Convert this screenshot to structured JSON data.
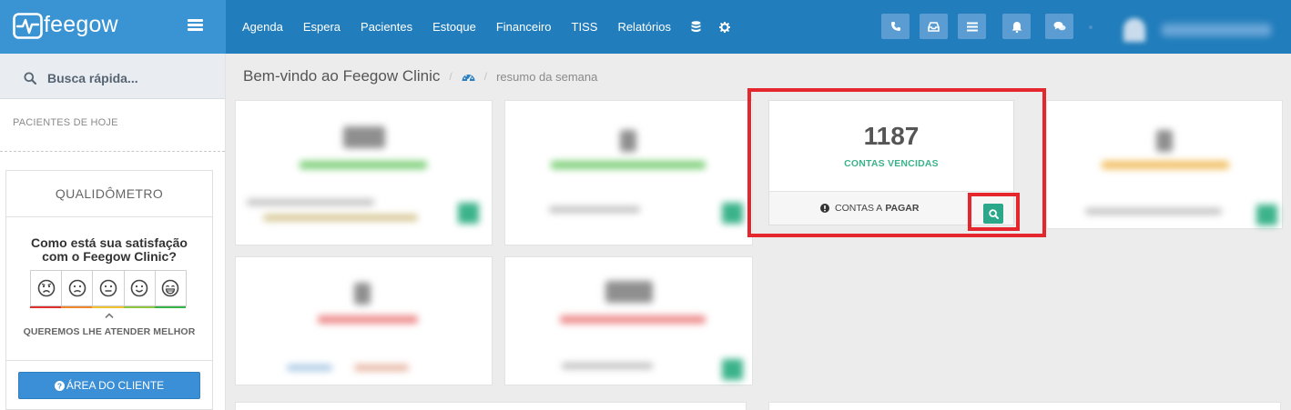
{
  "header": {
    "brand_name": "feegow",
    "nav": [
      "Agenda",
      "Espera",
      "Pacientes",
      "Estoque",
      "Financeiro",
      "TISS",
      "Relatórios"
    ],
    "nav_icons": [
      "database-icon",
      "gear-icon"
    ],
    "toolbar_buttons": [
      "phone-icon",
      "inbox-icon",
      "list-icon",
      "bell-icon",
      "chat-icon"
    ]
  },
  "sidebar": {
    "search_placeholder": "Busca rápida...",
    "pacientes_hoje": "PACIENTES DE HOJE",
    "qualidometro": {
      "title": "QUALIDÔMETRO",
      "question": "Como está sua satisfação com o Feegow Clinic?",
      "faces": [
        {
          "name": "very-unhappy-face-icon",
          "color": "#e0302e"
        },
        {
          "name": "unhappy-face-icon",
          "color": "#f0862b"
        },
        {
          "name": "neutral-face-icon",
          "color": "#f3c32f"
        },
        {
          "name": "happy-face-icon",
          "color": "#8dc63f"
        },
        {
          "name": "very-happy-face-icon",
          "color": "#37b34a"
        }
      ],
      "subtitle": "QUEREMOS LHE ATENDER MELHOR",
      "button_label": "ÁREA DO CLIENTE"
    }
  },
  "breadcrumb": {
    "title": "Bem-vindo ao Feegow Clinic",
    "sub": "resumo da semana"
  },
  "focused_card": {
    "value": "1187",
    "label": "CONTAS VENCIDAS",
    "footer_prefix": "CONTAS A",
    "footer_bold": "PAGAR"
  },
  "colors": {
    "header": "#217dbb",
    "brand": "#3a93d3",
    "accent_green": "#3bb38a",
    "highlight_red": "#e5262c"
  }
}
